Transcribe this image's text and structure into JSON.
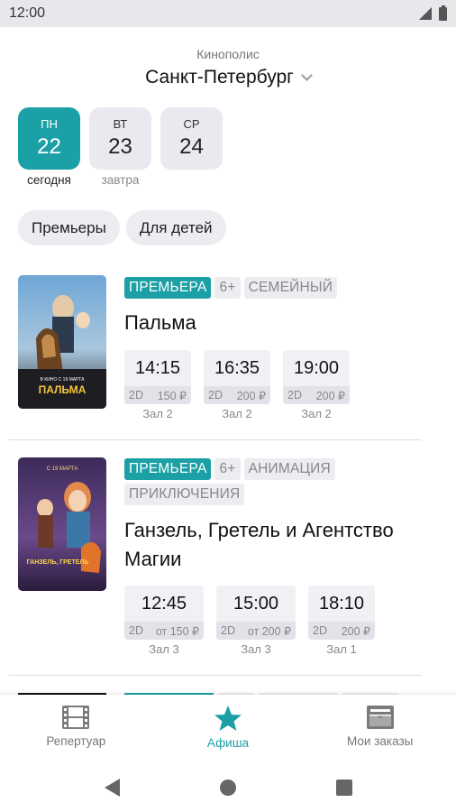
{
  "status_bar": {
    "time": "12:00"
  },
  "header": {
    "chain": "Кинополис",
    "city": "Санкт-Петербург"
  },
  "days": [
    {
      "weekday": "ПН",
      "date": "22",
      "sub": "сегодня",
      "active": true
    },
    {
      "weekday": "ВТ",
      "date": "23",
      "sub": "завтра",
      "active": false
    },
    {
      "weekday": "СР",
      "date": "24",
      "sub": "",
      "active": false
    }
  ],
  "filters": [
    "Премьеры",
    "Для детей"
  ],
  "movies": [
    {
      "title": "Пальма",
      "tags": [
        "ПРЕМЬЕРА",
        "6+",
        "СЕМЕЙНЫЙ"
      ],
      "poster_text": {
        "top": "ПАЛЬМА",
        "release": "В КИНО С 19 МАРТА"
      },
      "sessions": [
        {
          "time": "14:15",
          "format": "2D",
          "price": "150 ₽",
          "hall": "Зал 2"
        },
        {
          "time": "16:35",
          "format": "2D",
          "price": "200 ₽",
          "hall": "Зал 2"
        },
        {
          "time": "19:00",
          "format": "2D",
          "price": "200 ₽",
          "hall": "Зал 2"
        }
      ]
    },
    {
      "title": "Ганзель, Гретель и Агентство Магии",
      "tags": [
        "ПРЕМЬЕРА",
        "6+",
        "АНИМАЦИЯ",
        "ПРИКЛЮЧЕНИЯ"
      ],
      "poster_text": {
        "top": "С 19 МАРТА",
        "title": "ГАНЗЕЛЬ, ГРЕТЕЛЬ"
      },
      "sessions": [
        {
          "time": "12:45",
          "format": "2D",
          "price": "от 150 ₽",
          "hall": "Зал 3"
        },
        {
          "time": "15:00",
          "format": "2D",
          "price": "от 200 ₽",
          "hall": "Зал 3"
        },
        {
          "time": "18:10",
          "format": "2D",
          "price": "200 ₽",
          "hall": "Зал 1"
        }
      ]
    }
  ],
  "bottom_nav": [
    {
      "label": "Репертуар",
      "icon": "film-icon",
      "active": false
    },
    {
      "label": "Афиша",
      "icon": "star-icon",
      "active": true
    },
    {
      "label": "Мои заказы",
      "icon": "orders-icon",
      "active": false
    }
  ],
  "colors": {
    "accent": "#1ba0a5",
    "chip_bg": "#ececf1"
  }
}
